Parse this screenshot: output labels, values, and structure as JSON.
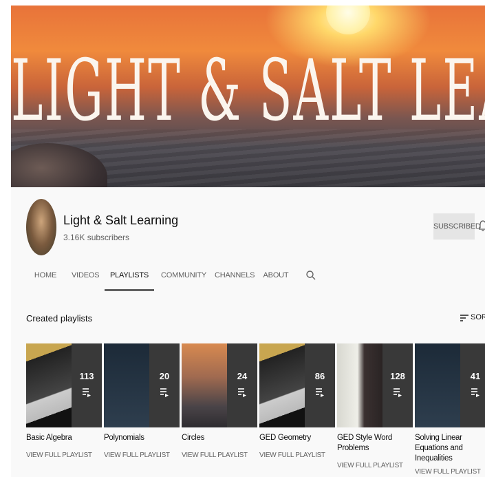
{
  "banner": {
    "title": "LIGHT & SALT LEARNING"
  },
  "channel": {
    "name": "Light & Salt Learning",
    "subscribers": "3.16K subscribers",
    "subscribe_button": "SUBSCRIBED",
    "bell_icon": "bell-icon"
  },
  "tabs": [
    {
      "label": "HOME"
    },
    {
      "label": "VIDEOS"
    },
    {
      "label": "PLAYLISTS"
    },
    {
      "label": "COMMUNITY"
    },
    {
      "label": "CHANNELS"
    },
    {
      "label": "ABOUT"
    }
  ],
  "active_tab": "PLAYLISTS",
  "section": {
    "title": "Created playlists",
    "sort_label": "SORT"
  },
  "playlists": [
    {
      "title": "Basic Algebra",
      "count": "113",
      "link": "VIEW FULL PLAYLIST",
      "thumb_color": "#4a4030"
    },
    {
      "title": "Polynomials",
      "count": "20",
      "link": "VIEW FULL PLAYLIST",
      "thumb_color": "#2a3a4a"
    },
    {
      "title": "Circles",
      "count": "24",
      "link": "VIEW FULL PLAYLIST",
      "thumb_color": "#8a6a50"
    },
    {
      "title": "GED Geometry",
      "count": "86",
      "link": "VIEW FULL PLAYLIST",
      "thumb_color": "#4a4030"
    },
    {
      "title": "GED Style Word Problems",
      "count": "128",
      "link": "VIEW FULL PLAYLIST",
      "thumb_color": "#c8c8c0"
    },
    {
      "title": "Solving Linear Equations and Inequalities",
      "count": "41",
      "link": "VIEW FULL PLAYLIST",
      "thumb_color": "#2a3a4a"
    }
  ],
  "colors": {
    "text_primary": "#0f0f0f",
    "text_secondary": "#606060",
    "background": "#f9f9f9",
    "subscribed_bg": "#e5e5e5"
  }
}
